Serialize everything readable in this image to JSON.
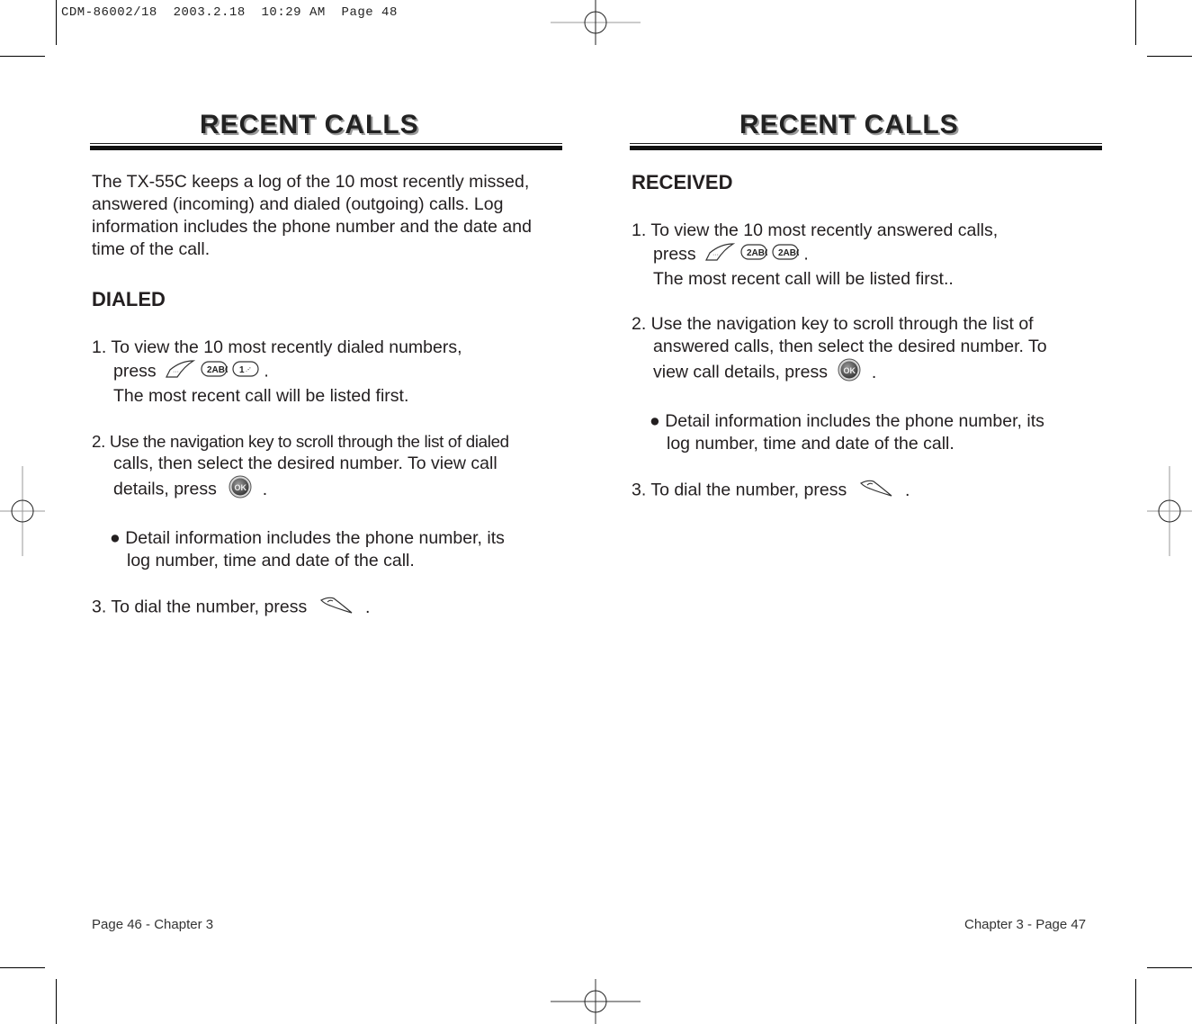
{
  "slug": {
    "text": "CDM-86002/18  2003.2.18  10:29 AM  Page 48"
  },
  "left_page": {
    "title": "RECENT CALLS",
    "intro": [
      "The TX-55C keeps a log of the 10 most recently missed,",
      "answered (incoming) and dialed (outgoing) calls. Log",
      "information includes the phone number and the date and",
      "time of the call."
    ],
    "section_heading": "DIALED",
    "step1": {
      "line1": "1. To view the 10 most recently dialed numbers,",
      "press_label": "press",
      "keys": [
        "menu-key-icon",
        "key-2-abc-icon",
        "key-1-icon"
      ],
      "key_labels": [
        "2ABC",
        "1"
      ],
      "end": ".",
      "line3": "The most recent call will be listed first."
    },
    "step2": {
      "line1": "2. Use the navigation key to scroll through the list of dialed",
      "line2": "calls, then select the desired number. To view call",
      "line3_prefix": "details, press",
      "key": "ok-key-icon",
      "key_label": "OK",
      "end": "."
    },
    "bullet": {
      "line1": "Detail information includes the phone number, its",
      "line2": "log number, time and date of the call."
    },
    "step3": {
      "prefix": "3. To dial the number, press",
      "key": "send-key-icon",
      "end": "."
    },
    "footer": "Page 46 - Chapter 3"
  },
  "right_page": {
    "title": "RECENT CALLS",
    "section_heading": "RECEIVED",
    "step1": {
      "line1": "1. To view the 10 most recently answered calls,",
      "press_label": "press",
      "keys": [
        "menu-key-icon",
        "key-2-abc-icon",
        "key-2-abc-icon"
      ],
      "key_labels": [
        "2ABC",
        "2ABC"
      ],
      "end": ".",
      "line3": "The most recent call will be listed first.."
    },
    "step2": {
      "line1": "2. Use the navigation key to scroll through the list of",
      "line2": "answered calls, then select the desired number. To",
      "line3_prefix": "view call details, press",
      "key": "ok-key-icon",
      "key_label": "OK",
      "end": "."
    },
    "bullet": {
      "line1": "Detail information includes the phone number, its",
      "line2": "log number, time and date of the call."
    },
    "step3": {
      "prefix": "3. To dial the number, press",
      "key": "send-key-icon",
      "end": "."
    },
    "footer": "Chapter 3 - Page 47"
  }
}
